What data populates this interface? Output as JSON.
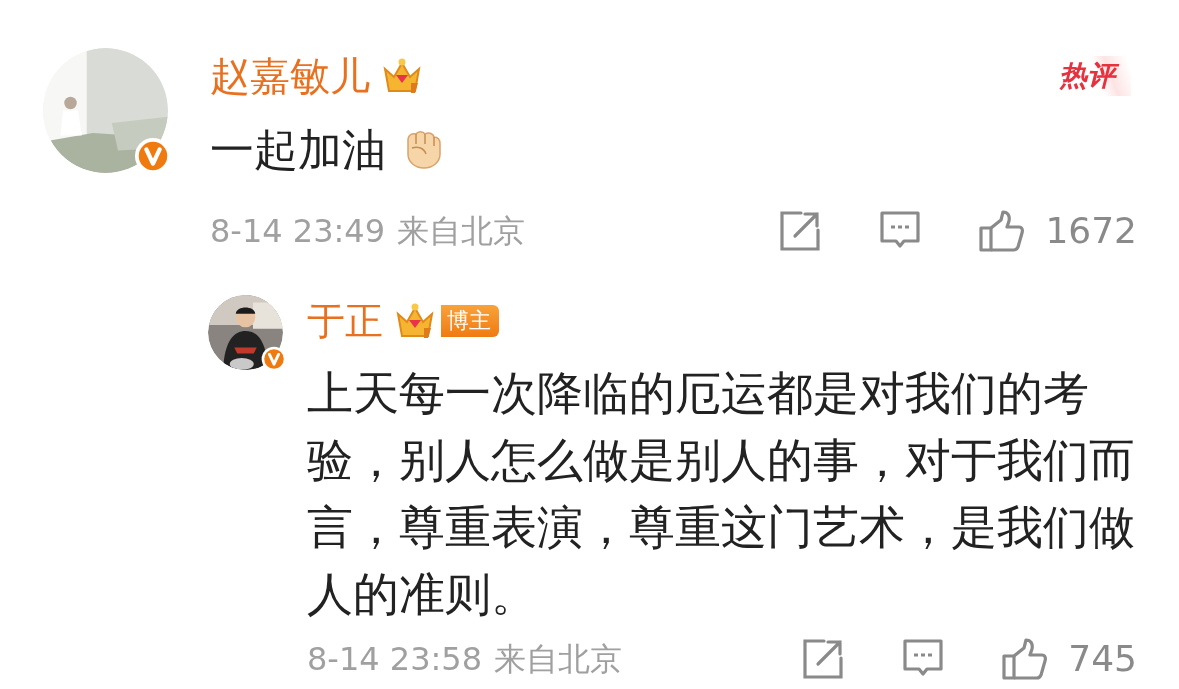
{
  "comment": {
    "author": "赵嘉敏儿",
    "verified": true,
    "tag": "热评",
    "text": "一起加油",
    "time": "8-14 23:49",
    "location": "来自北京",
    "likes": "1672",
    "replies": [
      {
        "author": "于正",
        "verified": true,
        "role_badge": "博主",
        "text": "上天每一次降临的厄运都是对我们的考验，别人怎么做是别人的事，对于我们而言，尊重表演，尊重这门艺术，是我们做人的准则。",
        "time": "8-14 23:58",
        "location": "来自北京",
        "likes": "745"
      }
    ]
  }
}
